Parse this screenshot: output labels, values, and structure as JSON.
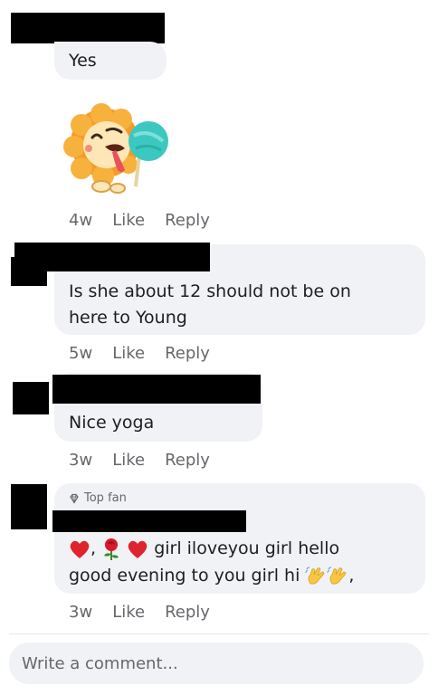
{
  "comments": [
    {
      "text": "Yes",
      "sticker": "lion-with-lollipop-sticker",
      "time": "4w",
      "like": "Like",
      "reply": "Reply"
    },
    {
      "text_line1": "Is she about 12 should not be on",
      "text_line2": "here to Young",
      "time": "5w",
      "like": "Like",
      "reply": "Reply"
    },
    {
      "text": "Nice yoga",
      "time": "3w",
      "like": "Like",
      "reply": "Reply"
    },
    {
      "badge": "Top fan",
      "text_line1_a": ",",
      "text_line1_b": "girl iloveyou girl hello",
      "text_line2_a": "good evening to you girl hi",
      "text_line2_b": ",",
      "time": "3w",
      "like": "Like",
      "reply": "Reply"
    }
  ],
  "composer": {
    "placeholder": "Write a comment..."
  },
  "colors": {
    "bubble": "#f0f2f5",
    "meta": "#65676b",
    "text": "#1c1e21"
  }
}
